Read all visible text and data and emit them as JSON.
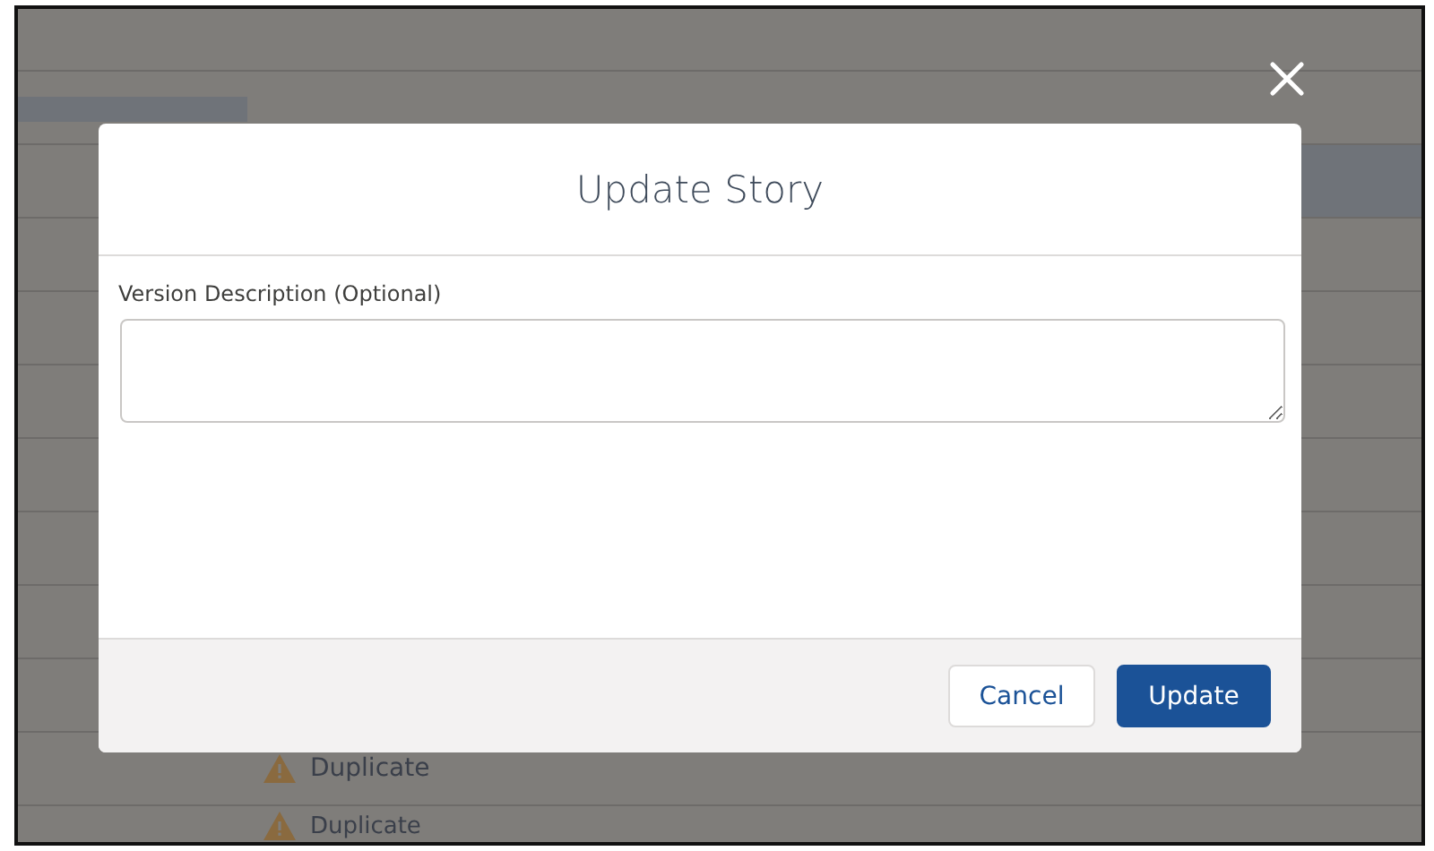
{
  "background": {
    "rows": [
      {
        "selected": false
      },
      {
        "selected": false
      },
      {
        "selected": true
      },
      {
        "selected": false
      },
      {
        "selected": false
      },
      {
        "selected": false
      },
      {
        "selected": false
      },
      {
        "selected": false
      },
      {
        "selected": false
      },
      {
        "selected": false
      },
      {
        "selected": false,
        "status": {
          "kind": "warning",
          "label": "Duplicate"
        }
      },
      {
        "selected": false,
        "status": {
          "kind": "warning",
          "label": "Duplicate"
        }
      }
    ]
  },
  "modal": {
    "title": "Update Story",
    "field": {
      "label": "Version Description (Optional)"
    },
    "buttons": [
      {
        "label": "Cancel",
        "kind": "neutral"
      },
      {
        "label": "Update",
        "kind": "brand"
      }
    ]
  }
}
